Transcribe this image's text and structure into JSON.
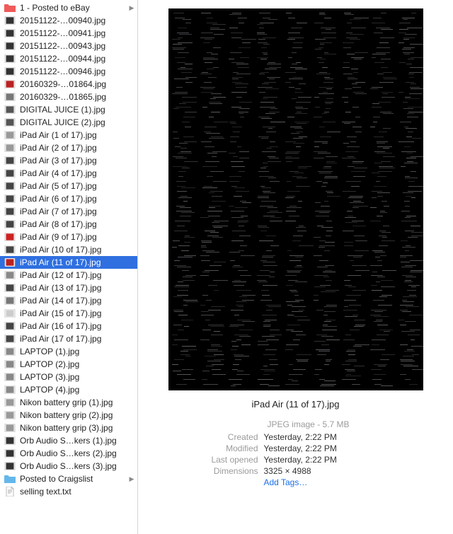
{
  "sidebar": {
    "items": [
      {
        "label": "1 - Posted to eBay",
        "type": "folder",
        "color": "#f05a5a",
        "discloses": true
      },
      {
        "label": "20151122-…00940.jpg",
        "type": "thumb",
        "cl": "#333"
      },
      {
        "label": "20151122-…00941.jpg",
        "type": "thumb",
        "cl": "#333"
      },
      {
        "label": "20151122-…00943.jpg",
        "type": "thumb",
        "cl": "#333"
      },
      {
        "label": "20151122-…00944.jpg",
        "type": "thumb",
        "cl": "#333"
      },
      {
        "label": "20151122-…00946.jpg",
        "type": "thumb",
        "cl": "#333"
      },
      {
        "label": "20160329-…01864.jpg",
        "type": "thumb",
        "cl": "#b22"
      },
      {
        "label": "20160329-…01865.jpg",
        "type": "thumb",
        "cl": "#777"
      },
      {
        "label": "DIGITAL JUICE (1).jpg",
        "type": "thumb",
        "cl": "#555"
      },
      {
        "label": "DIGITAL JUICE (2).jpg",
        "type": "thumb",
        "cl": "#555"
      },
      {
        "label": "iPad Air (1 of 17).jpg",
        "type": "thumb",
        "cl": "#999"
      },
      {
        "label": "iPad Air (2 of 17).jpg",
        "type": "thumb",
        "cl": "#999"
      },
      {
        "label": "iPad Air (3 of 17).jpg",
        "type": "thumb",
        "cl": "#444"
      },
      {
        "label": "iPad Air (4 of 17).jpg",
        "type": "thumb",
        "cl": "#444"
      },
      {
        "label": "iPad Air (5 of 17).jpg",
        "type": "thumb",
        "cl": "#444"
      },
      {
        "label": "iPad Air (6 of 17).jpg",
        "type": "thumb",
        "cl": "#444"
      },
      {
        "label": "iPad Air (7 of 17).jpg",
        "type": "thumb",
        "cl": "#444"
      },
      {
        "label": "iPad Air (8 of 17).jpg",
        "type": "thumb",
        "cl": "#444"
      },
      {
        "label": "iPad Air (9 of 17).jpg",
        "type": "thumb",
        "cl": "#c22"
      },
      {
        "label": "iPad Air (10 of 17).jpg",
        "type": "thumb",
        "cl": "#444"
      },
      {
        "label": "iPad Air (11 of 17).jpg",
        "type": "thumb",
        "cl": "#b22",
        "selected": true
      },
      {
        "label": "iPad Air (12 of 17).jpg",
        "type": "thumb",
        "cl": "#888"
      },
      {
        "label": "iPad Air (13 of 17).jpg",
        "type": "thumb",
        "cl": "#444"
      },
      {
        "label": "iPad Air (14 of 17).jpg",
        "type": "thumb",
        "cl": "#777"
      },
      {
        "label": "iPad Air (15 of 17).jpg",
        "type": "thumb",
        "cl": "#ccc"
      },
      {
        "label": "iPad Air (16 of 17).jpg",
        "type": "thumb",
        "cl": "#444"
      },
      {
        "label": "iPad Air (17 of 17).jpg",
        "type": "thumb",
        "cl": "#444"
      },
      {
        "label": "LAPTOP (1).jpg",
        "type": "thumb",
        "cl": "#888"
      },
      {
        "label": "LAPTOP (2).jpg",
        "type": "thumb",
        "cl": "#888"
      },
      {
        "label": "LAPTOP (3).jpg",
        "type": "thumb",
        "cl": "#888"
      },
      {
        "label": "LAPTOP (4).jpg",
        "type": "thumb",
        "cl": "#888"
      },
      {
        "label": "Nikon battery grip (1).jpg",
        "type": "thumb",
        "cl": "#999"
      },
      {
        "label": "Nikon battery grip (2).jpg",
        "type": "thumb",
        "cl": "#999"
      },
      {
        "label": "Nikon battery grip (3).jpg",
        "type": "thumb",
        "cl": "#999"
      },
      {
        "label": "Orb Audio S…kers (1).jpg",
        "type": "thumb",
        "cl": "#333"
      },
      {
        "label": "Orb Audio S…kers (2).jpg",
        "type": "thumb",
        "cl": "#333"
      },
      {
        "label": "Orb Audio S…kers (3).jpg",
        "type": "thumb",
        "cl": "#333"
      },
      {
        "label": "Posted to Craigslist",
        "type": "folder",
        "color": "#63b7ea",
        "discloses": true
      },
      {
        "label": "selling text.txt",
        "type": "txt"
      }
    ]
  },
  "preview": {
    "filename": "iPad Air (11 of 17).jpg",
    "type_line": "JPEG image - 5.7 MB",
    "rows": [
      {
        "k": "Created",
        "v": "Yesterday, 2:22 PM"
      },
      {
        "k": "Modified",
        "v": "Yesterday, 2:22 PM"
      },
      {
        "k": "Last opened",
        "v": "Yesterday, 2:22 PM"
      },
      {
        "k": "Dimensions",
        "v": "3325 × 4988"
      }
    ],
    "add_tags": "Add Tags…"
  }
}
